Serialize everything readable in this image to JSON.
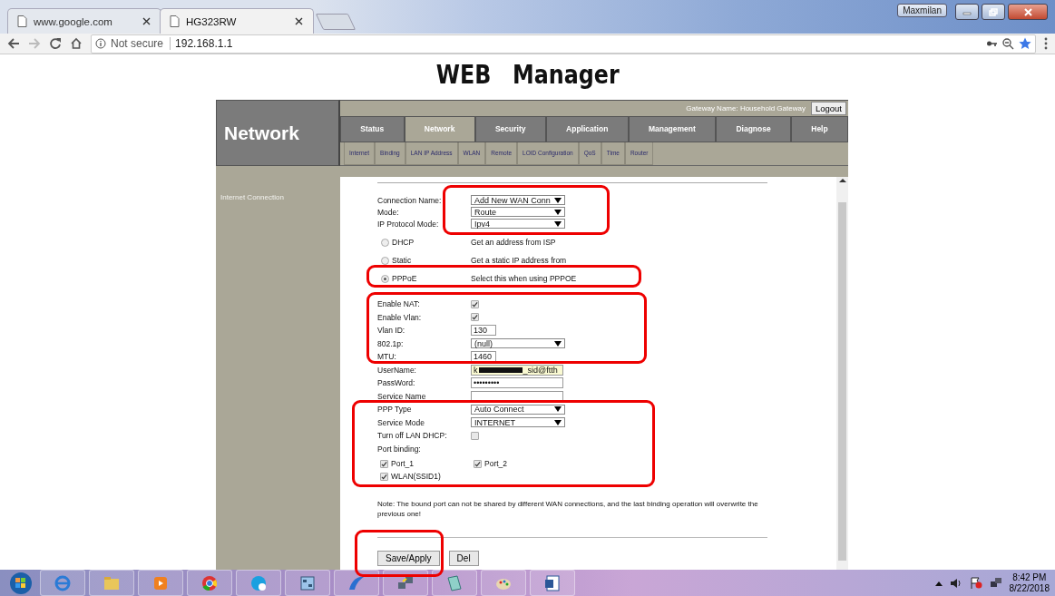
{
  "browser": {
    "tabs": [
      {
        "title": "www.google.com",
        "selected": false
      },
      {
        "title": "HG323RW",
        "selected": true
      }
    ],
    "window_user": "Maxmilan",
    "address": {
      "security": "Not secure",
      "url": "192.168.1.1"
    }
  },
  "page_title": "WEB Manager",
  "router": {
    "section_title": "Network",
    "gateway_name": "Gateway Name: Household Gateway",
    "logout": "Logout",
    "tabs": [
      {
        "label": "Status",
        "selected": false
      },
      {
        "label": "Network",
        "selected": true
      },
      {
        "label": "Security",
        "selected": false
      },
      {
        "label": "Application",
        "selected": false
      },
      {
        "label": "Management",
        "selected": false
      },
      {
        "label": "Diagnose",
        "selected": false
      },
      {
        "label": "Help",
        "selected": false
      }
    ],
    "subtabs": [
      {
        "label": "Internet"
      },
      {
        "label": "Binding"
      },
      {
        "label": "LAN IP Address"
      },
      {
        "label": "WLAN"
      },
      {
        "label": "Remote"
      },
      {
        "label": "LOID Configuration"
      },
      {
        "label": "QoS"
      },
      {
        "label": "Time"
      },
      {
        "label": "Router"
      }
    ],
    "sidebar": {
      "items": [
        {
          "label": "Internet Connection"
        }
      ]
    },
    "form": {
      "rows": [
        {
          "kind": "select",
          "label": "Connection Name:",
          "value": "Add New WAN Conn"
        },
        {
          "kind": "select",
          "label": "Mode:",
          "value": "Route"
        },
        {
          "kind": "select",
          "label": "IP Protocol Mode:",
          "value": "Ipv4"
        },
        {
          "kind": "radio",
          "label": "DHCP",
          "selected": false,
          "description": "Get an address from ISP"
        },
        {
          "kind": "radio",
          "label": "Static",
          "selected": false,
          "description": "Get a static IP address from"
        },
        {
          "kind": "radio",
          "label": "PPPoE",
          "selected": true,
          "description": "Select this when using PPPOE"
        },
        {
          "kind": "checkbox",
          "label": "Enable NAT:",
          "checked": true
        },
        {
          "kind": "checkbox",
          "label": "Enable Vlan:",
          "checked": true
        },
        {
          "kind": "text",
          "label": "Vlan ID:",
          "value": "130"
        },
        {
          "kind": "select",
          "label": "802.1p:",
          "value": "(null)"
        },
        {
          "kind": "text",
          "label": "MTU:",
          "value": "1460"
        },
        {
          "kind": "username",
          "label": "UserName:",
          "value_start": "k",
          "value_end": "_sid@ftth",
          "redacted": true
        },
        {
          "kind": "password",
          "label": "PassWord:",
          "value": "•••••••••"
        },
        {
          "kind": "text",
          "label": "Service Name"
        },
        {
          "kind": "select",
          "label": "PPP Type",
          "value": "Auto Connect"
        },
        {
          "kind": "select",
          "label": "Service Mode",
          "value": "INTERNET"
        },
        {
          "kind": "checkbox",
          "label": "Turn off LAN DHCP:",
          "checked": false
        },
        {
          "kind": "heading",
          "label": "Port binding:"
        },
        {
          "kind": "ports",
          "ports": [
            {
              "label": "Port_1",
              "checked": true
            },
            {
              "label": "Port_2",
              "checked": true
            },
            {
              "label": "WLAN(SSID1)",
              "checked": true
            }
          ]
        }
      ],
      "note": "Note: The bound port can not be shared by different WAN connections, and the last binding operation will overwrite the previous one!",
      "buttons": [
        "Save/Apply",
        "Del"
      ]
    }
  },
  "taskbar": {
    "time": "8:42 PM",
    "date": "8/22/2018"
  }
}
